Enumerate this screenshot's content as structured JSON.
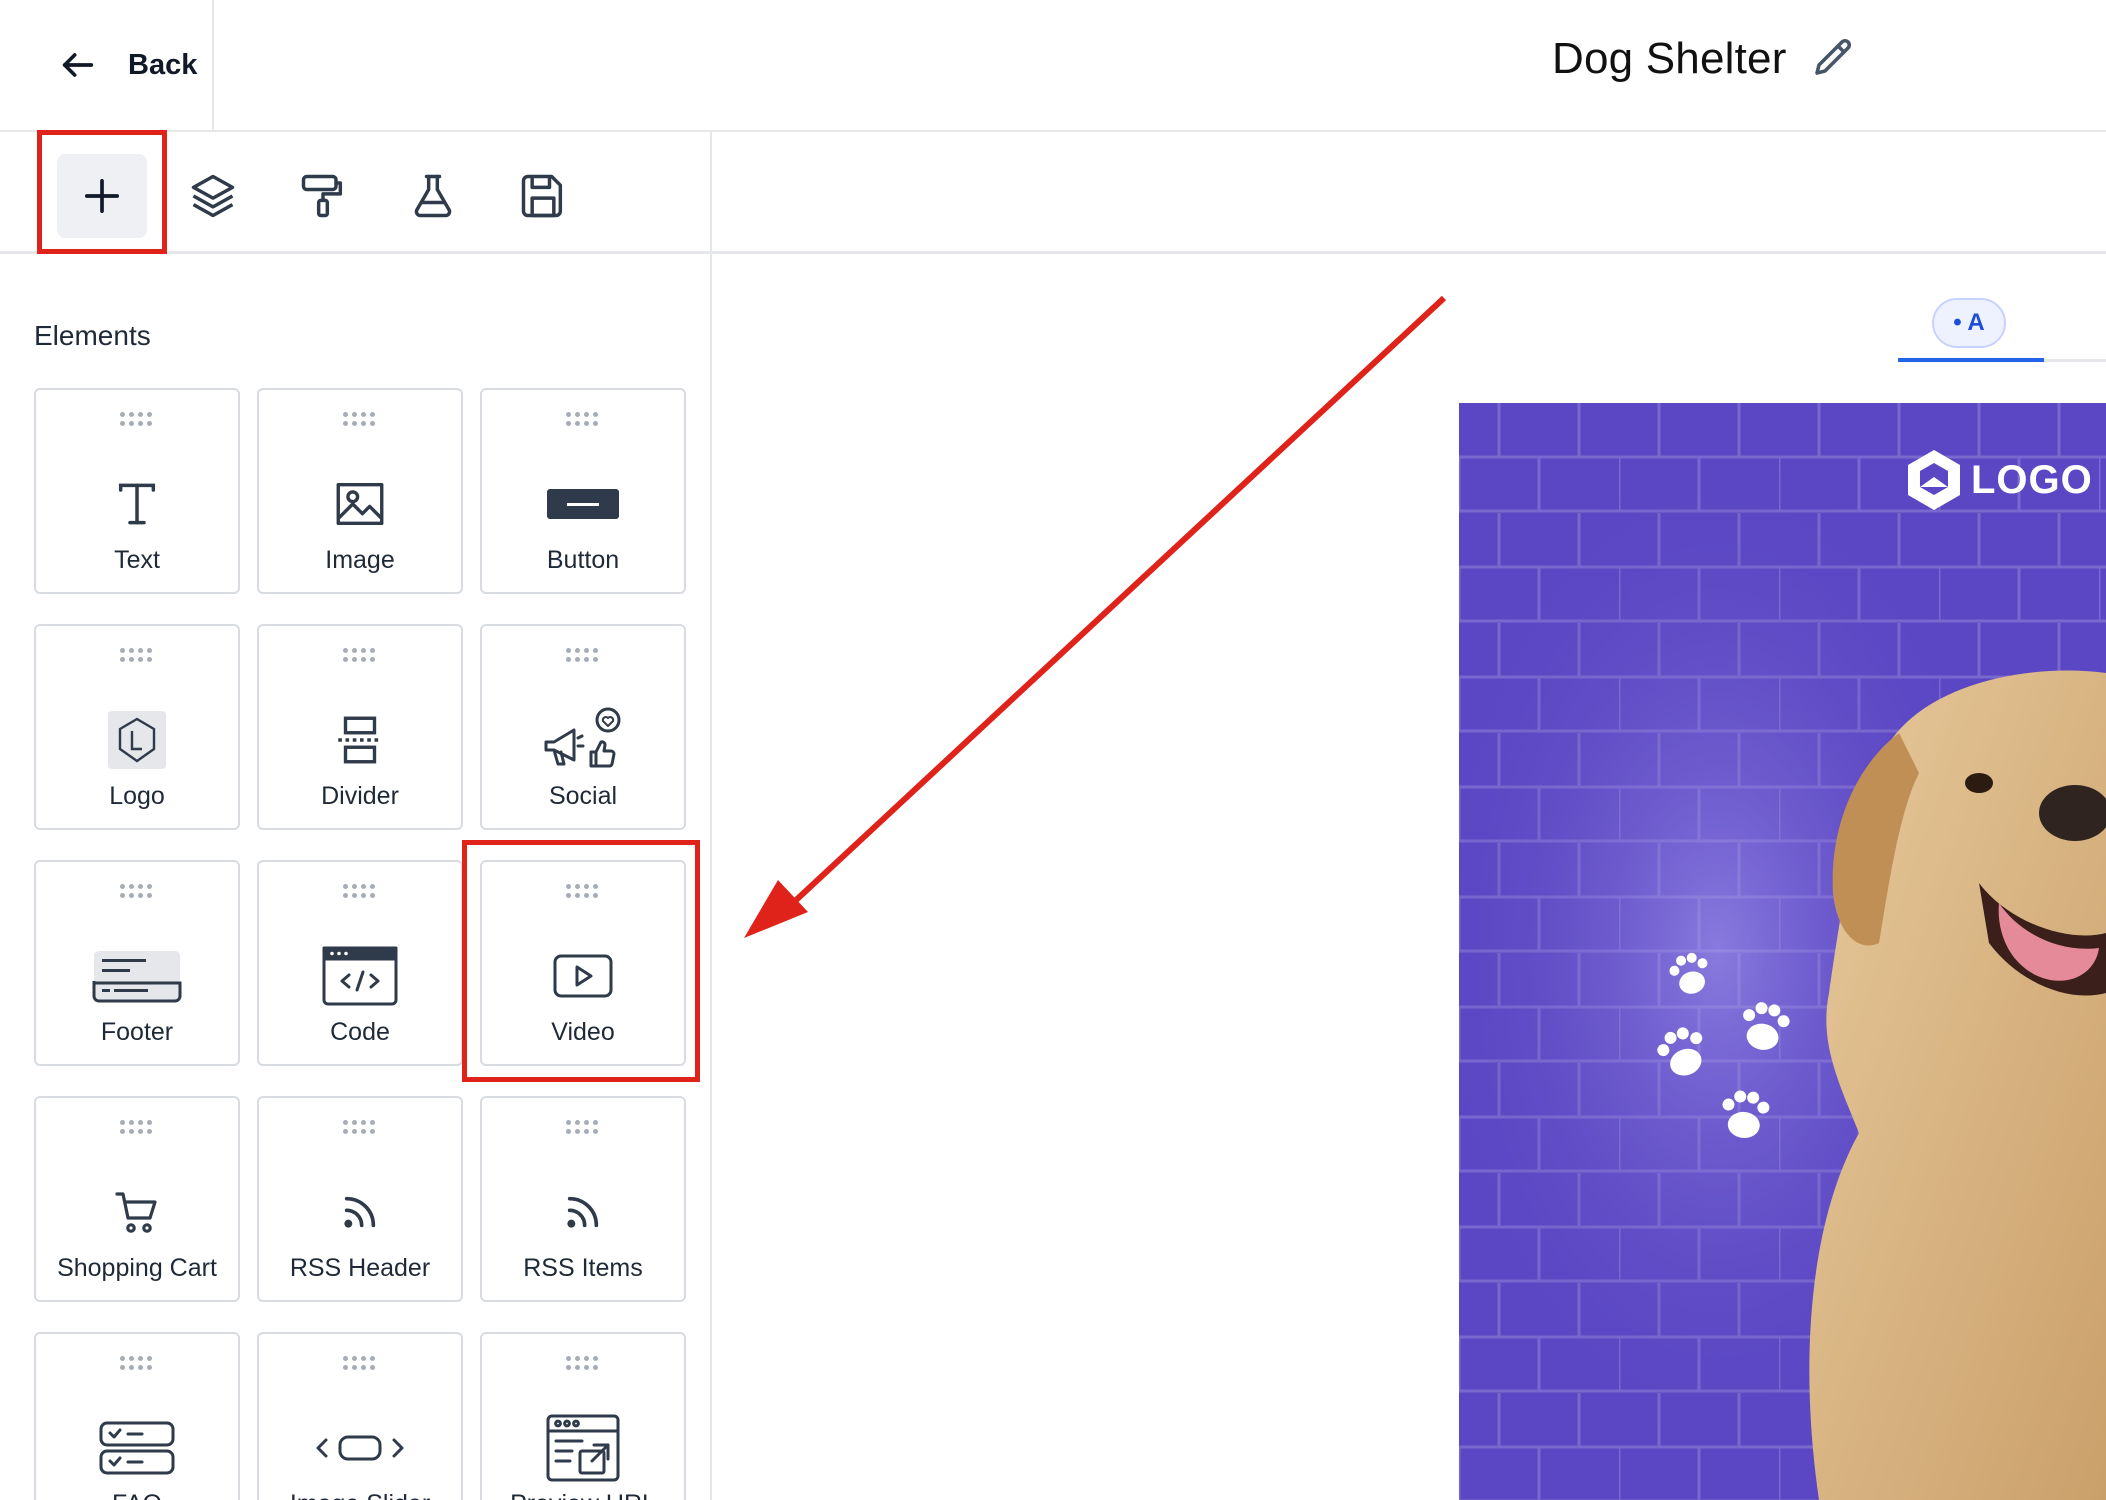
{
  "header": {
    "back_label": "Back",
    "title": "Dog Shelter"
  },
  "toolbar": {
    "tools": [
      {
        "name": "add",
        "icon": "plus-icon",
        "active": true
      },
      {
        "name": "layers",
        "icon": "layers-icon"
      },
      {
        "name": "styles",
        "icon": "paint-roller-icon"
      },
      {
        "name": "test",
        "icon": "flask-icon"
      },
      {
        "name": "save",
        "icon": "save-icon"
      }
    ]
  },
  "elements_panel": {
    "heading": "Elements",
    "items": [
      {
        "label": "Text",
        "icon": "text-icon"
      },
      {
        "label": "Image",
        "icon": "image-icon"
      },
      {
        "label": "Button",
        "icon": "button-icon"
      },
      {
        "label": "Logo",
        "icon": "logo-icon"
      },
      {
        "label": "Divider",
        "icon": "divider-icon"
      },
      {
        "label": "Social",
        "icon": "social-icon"
      },
      {
        "label": "Footer",
        "icon": "footer-icon"
      },
      {
        "label": "Code",
        "icon": "code-icon"
      },
      {
        "label": "Video",
        "icon": "video-icon"
      },
      {
        "label": "Shopping Cart",
        "icon": "shopping-cart-icon"
      },
      {
        "label": "RSS Header",
        "icon": "rss-icon"
      },
      {
        "label": "RSS Items",
        "icon": "rss-icon"
      },
      {
        "label": "FAQ",
        "icon": "faq-icon"
      },
      {
        "label": "Image Slider",
        "icon": "image-slider-icon"
      },
      {
        "label": "Preview URL",
        "icon": "preview-url-icon"
      }
    ]
  },
  "canvas": {
    "variant_tab": "• A",
    "preview_logo_text": "LOGO"
  },
  "colors": {
    "accent": "#2563eb",
    "highlight": "#e0231a",
    "preview_bg": "#5b47c3",
    "icon": "#2f3a4a"
  }
}
